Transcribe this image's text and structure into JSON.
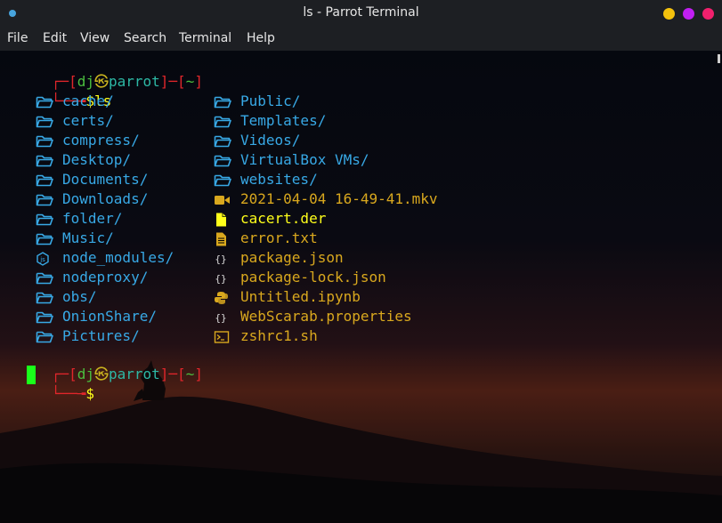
{
  "window": {
    "title": "ls  - Parrot Terminal"
  },
  "colors": {
    "dir": "#38a9e6",
    "file_yellow": "#d9a81e",
    "file_bright": "#ffff1a",
    "bracket_red": "#e0262b",
    "user_green": "#4bbf3f",
    "host_cyan": "#2db8a5",
    "at_yellow": "#c8b21f",
    "cursor": "#1aff1a",
    "btn_yellow": "#f4c20d",
    "btn_magenta": "#c11ff2",
    "btn_pink": "#f2206d",
    "app_dot": "#47a4dd"
  },
  "menu": [
    "File",
    "Edit",
    "View",
    "Search",
    "Terminal",
    "Help"
  ],
  "prompt": {
    "open": "┌─[",
    "user": "dj",
    "at": "㉿",
    "host": "parrot",
    "mid": "]─[",
    "path": "~",
    "close": "]",
    "corner": "└──╼",
    "dollar": "$"
  },
  "command": "ls",
  "listing": {
    "col1": [
      {
        "icon": "folder-icon",
        "name": "cache/"
      },
      {
        "icon": "folder-icon",
        "name": "certs/"
      },
      {
        "icon": "folder-icon",
        "name": "compress/"
      },
      {
        "icon": "folder-icon",
        "name": "Desktop/"
      },
      {
        "icon": "folder-icon",
        "name": "Documents/"
      },
      {
        "icon": "folder-icon",
        "name": "Downloads/"
      },
      {
        "icon": "folder-icon",
        "name": "folder/"
      },
      {
        "icon": "folder-icon",
        "name": "Music/"
      },
      {
        "icon": "nodejs-icon",
        "name": "node_modules/"
      },
      {
        "icon": "folder-icon",
        "name": "nodeproxy/"
      },
      {
        "icon": "folder-icon",
        "name": "obs/"
      },
      {
        "icon": "folder-icon",
        "name": "OnionShare/"
      },
      {
        "icon": "folder-icon",
        "name": "Pictures/"
      }
    ],
    "col2": [
      {
        "icon": "folder-icon",
        "name": "Public/"
      },
      {
        "icon": "folder-icon",
        "name": "Templates/"
      },
      {
        "icon": "folder-icon",
        "name": "Videos/"
      },
      {
        "icon": "folder-icon",
        "name": "VirtualBox VMs/"
      },
      {
        "icon": "folder-icon",
        "name": "websites/"
      },
      {
        "icon": "video-icon",
        "name": "2021-04-04 16-49-41.mkv"
      },
      {
        "icon": "file-icon",
        "name": "cacert.der"
      },
      {
        "icon": "text-file-icon",
        "name": "error.txt"
      },
      {
        "icon": "json-icon",
        "name": "package.json"
      },
      {
        "icon": "json-icon",
        "name": "package-lock.json"
      },
      {
        "icon": "python-icon",
        "name": "Untitled.ipynb"
      },
      {
        "icon": "json-icon",
        "name": "WebScarab.properties"
      },
      {
        "icon": "terminal-icon",
        "name": "zshrc1.sh"
      }
    ]
  }
}
